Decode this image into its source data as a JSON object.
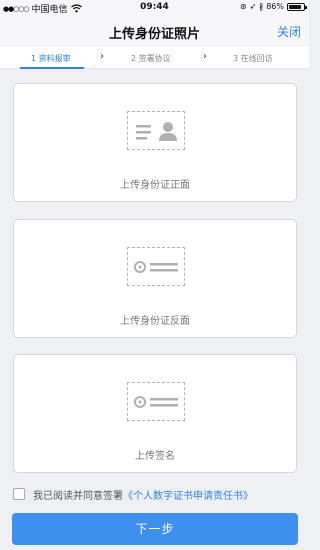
{
  "status_bar": {
    "carrier": "中国电信",
    "time": "09:44",
    "battery": "86%"
  },
  "nav": {
    "title": "上传身份证照片",
    "close_label": "关闭"
  },
  "steps": [
    {
      "label": "1 资料报审",
      "active": true
    },
    {
      "label": "2 签署协议",
      "active": false
    },
    {
      "label": "3 在线回访",
      "active": false
    }
  ],
  "cards": [
    {
      "label": "上传身份证正面",
      "icon": "id-card-front-icon"
    },
    {
      "label": "上传身份证反面",
      "icon": "id-card-back-icon"
    },
    {
      "label": "上传签名",
      "icon": "signature-icon"
    }
  ],
  "agreement": {
    "prefix": "我已阅读并同意签署",
    "link": "《个人数字证书申请责任书》"
  },
  "next_button_label": "下一步",
  "colors": {
    "accent": "#2f84e6",
    "button": "#3d8ff0",
    "background": "#eff0f4"
  }
}
